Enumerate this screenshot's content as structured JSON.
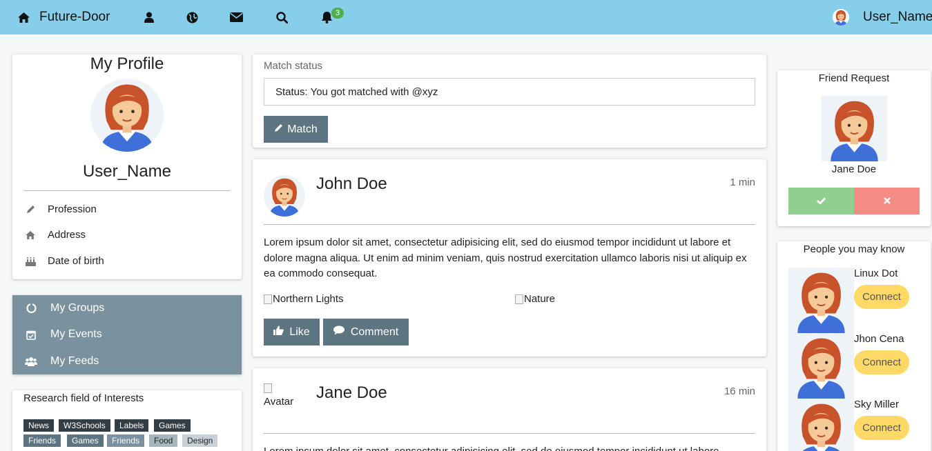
{
  "navbar": {
    "brand": "Future-Door",
    "icons": [
      "home-icon",
      "user-icon",
      "globe-icon",
      "envelope-icon",
      "search-icon",
      "bell-icon"
    ],
    "notification_count": "3",
    "username": "User_Name",
    "background": "#87ceeb"
  },
  "profile": {
    "title": "My Profile",
    "username": "User_Name",
    "info": [
      {
        "icon": "pencil-icon",
        "label": "Profession"
      },
      {
        "icon": "home-icon",
        "label": "Address"
      },
      {
        "icon": "birthday-cake-icon",
        "label": "Date of birth"
      }
    ]
  },
  "menu": {
    "items": [
      {
        "icon": "circle-notch-icon",
        "label": "My Groups"
      },
      {
        "icon": "calendar-check-icon",
        "label": "My Events"
      },
      {
        "icon": "users-icon",
        "label": "My Feeds"
      }
    ],
    "background": "#7a929f"
  },
  "interests": {
    "title": "Research field of Interests",
    "tags": [
      "News",
      "W3Schools",
      "Labels",
      "Games",
      "Friends",
      "Games",
      "Friends",
      "Food",
      "Design"
    ]
  },
  "status": {
    "label": "Match status",
    "value": "Status: You got matched with @xyz",
    "button": "Match"
  },
  "posts": [
    {
      "name": "John Doe",
      "time": "1 min",
      "text": "Lorem ipsum dolor sit amet, consectetur adipisicing elit, sed do eiusmod tempor incididunt ut labore et dolore magna aliqua. Ut enim ad minim veniam, quis nostrud exercitation ullamco laboris nisi ut aliquip ex ea commodo consequat.",
      "images": [
        "Northern Lights",
        "Nature"
      ],
      "like": "Like",
      "comment": "Comment"
    },
    {
      "name": "Jane Doe",
      "time": "16 min",
      "avatar_alt": "Avatar",
      "text": "Lorem ipsum dolor sit amet, consectetur adipisicing elit, sed do eiusmod tempor incididunt ut labore"
    }
  ],
  "friend_request": {
    "title": "Friend Request",
    "name": "Jane Doe",
    "accept_color": "#8fcf8f",
    "decline_color": "#f48c85"
  },
  "people": {
    "title": "People you may know",
    "items": [
      {
        "name": "Linux Dot",
        "button": "Connect"
      },
      {
        "name": "Jhon Cena",
        "button": "Connect"
      },
      {
        "name": "Sky Miller",
        "button": "Connect"
      }
    ]
  }
}
